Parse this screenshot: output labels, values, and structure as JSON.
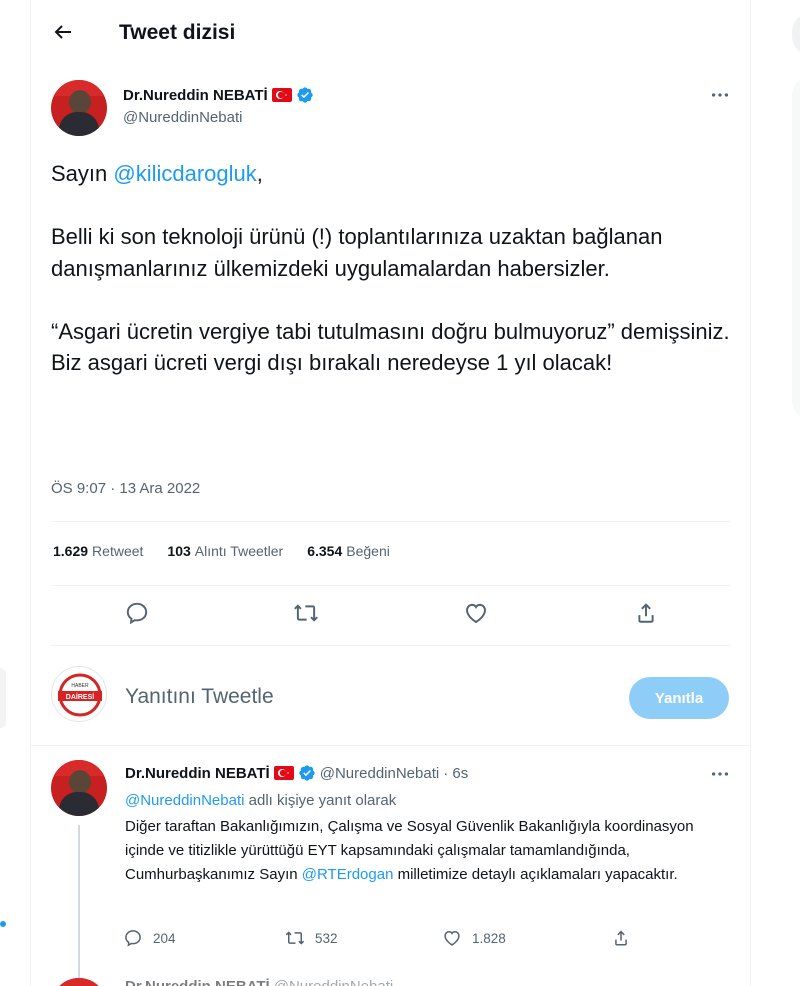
{
  "header": {
    "title": "Tweet dizisi",
    "back_icon": "back-arrow-icon"
  },
  "main_tweet": {
    "author_name": "Dr.Nureddin NEBATİ",
    "handle": "@NureddinNebati",
    "paragraph1_prefix": "Sayın ",
    "paragraph1_mention": "@kilicdarogluk",
    "paragraph1_suffix": ",",
    "paragraph2": "Belli ki son teknoloji ürünü (!) toplantılarınıza uzaktan bağlanan danışmanlarınız ülkemizdeki uygulamalardan habersizler.",
    "paragraph3": "“Asgari ücretin vergiye tabi tutulmasını doğru bulmuyoruz” demişsiniz. Biz asgari ücreti vergi dışı bırakalı neredeyse 1 yıl olacak!",
    "timestamp": "ÖS 9:07 · 13 Ara 2022",
    "stats": {
      "retweet_count": "1.629",
      "retweet_label": "Retweet",
      "quote_count": "103",
      "quote_label": "Alıntı Tweetler",
      "like_count": "6.354",
      "like_label": "Beğeni"
    }
  },
  "reply_composer": {
    "placeholder": "Yanıtını Tweetle",
    "button_label": "Yanıtla",
    "avatar_text": "DAİRESİ",
    "avatar_top": "HABER"
  },
  "reply_tweet": {
    "author_name": "Dr.Nureddin NEBATİ",
    "handle": "@NureddinNebati",
    "time": "· 6s",
    "replying_mention": "@NureddinNebati",
    "replying_suffix": " adlı kişiye yanıt olarak",
    "text_part1": "Diğer taraftan Bakanlığımızın, Çalışma ve Sosyal Güvenlik Bakanlığıyla koordinasyon içinde ve titizlikle yürüttüğü EYT kapsamındaki çalışmalar tamamlandığında, Cumhurbaşkanımız Sayın ",
    "text_mention": "@RTErdogan",
    "text_part2": " milletimize detaylı açıklamaları yapacaktır.",
    "reply_count": "204",
    "retweet_count": "532",
    "like_count": "1.828"
  },
  "next_tweet": {
    "author_name": "Dr.Nureddin NEBATİ",
    "handle": "@NureddinNebati"
  },
  "colors": {
    "accent": "#1d9bf0",
    "text": "#0f1419",
    "muted": "#536471",
    "button_disabled": "#8ecdf8"
  }
}
